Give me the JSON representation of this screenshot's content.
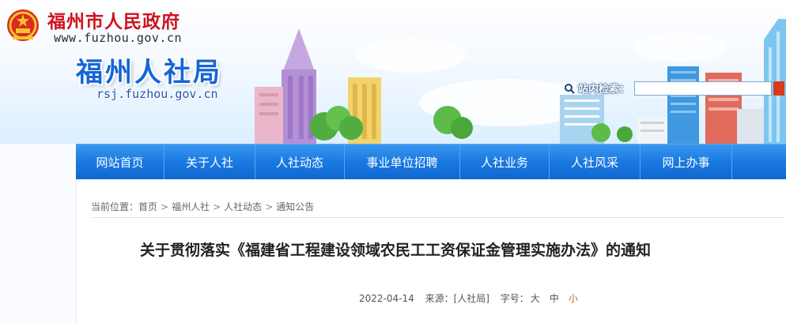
{
  "header": {
    "gov_title": "福州市人民政府",
    "gov_url": "www.fuzhou.gov.cn",
    "dept_title": "福州人社局",
    "dept_url": "rsj.fuzhou.gov.cn",
    "emblem_icon": "national-emblem-icon"
  },
  "search": {
    "label": "站内检索：",
    "value": "",
    "placeholder": "",
    "icon": "magnifier-icon"
  },
  "nav": {
    "items": [
      {
        "label": "网站首页"
      },
      {
        "label": "关于人社"
      },
      {
        "label": "人社动态"
      },
      {
        "label": "事业单位招聘"
      },
      {
        "label": "人社业务"
      },
      {
        "label": "人社风采"
      },
      {
        "label": "网上办事"
      }
    ]
  },
  "breadcrumb": {
    "prefix": "当前位置：",
    "items": [
      "首页",
      "福州人社",
      "人社动态",
      "通知公告"
    ],
    "separator": ">"
  },
  "article": {
    "title": "关于贯彻落实《福建省工程建设领域农民工工资保证金管理实施办法》的通知",
    "date": "2022-04-14",
    "source": "来源：[人社局]",
    "font_size_label": "字号：",
    "size_large": "大",
    "size_medium": "中",
    "size_small": "小"
  },
  "colors": {
    "nav_blue": "#1c7be3",
    "gov_red": "#d0141e",
    "dept_blue": "#1565d8",
    "active_size": "#d2691e"
  }
}
